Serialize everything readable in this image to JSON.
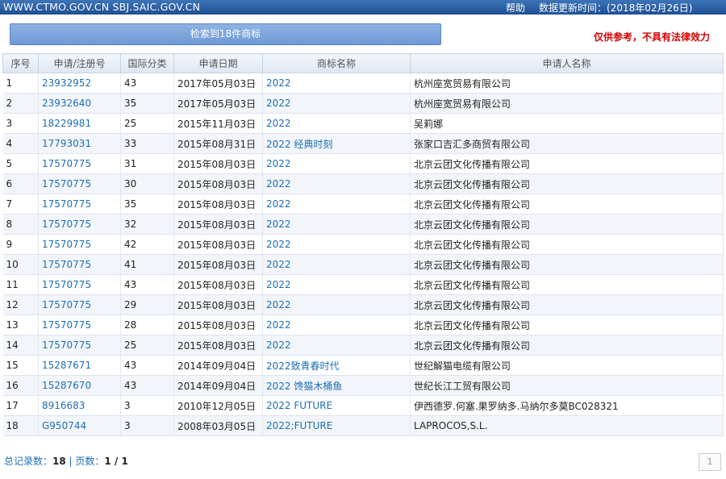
{
  "topbar": {
    "site_text": "WWW.CTMO.GOV.CN SBJ.SAIC.GOV.CN",
    "help_label": "帮助",
    "update_text": "数据更新时间：(2018年02月26日)"
  },
  "search": {
    "result_label": "检索到18件商标"
  },
  "disclaimer": "仅供参考，不具有法律效力",
  "table": {
    "headers": [
      "序号",
      "申请/注册号",
      "国际分类",
      "申请日期",
      "商标名称",
      "申请人名称"
    ],
    "rows": [
      [
        "1",
        "23932952",
        "43",
        "2017年05月03日",
        "2022",
        "杭州座宽贸易有限公司"
      ],
      [
        "2",
        "23932640",
        "35",
        "2017年05月03日",
        "2022",
        "杭州座宽贸易有限公司"
      ],
      [
        "3",
        "18229981",
        "25",
        "2015年11月03日",
        "2022",
        "吴莉娜"
      ],
      [
        "4",
        "17793031",
        "33",
        "2015年08月31日",
        "2022 经典时刻",
        "张家口吉汇多商贸有限公司"
      ],
      [
        "5",
        "17570775",
        "31",
        "2015年08月03日",
        "2022",
        "北京云团文化传播有限公司"
      ],
      [
        "6",
        "17570775",
        "30",
        "2015年08月03日",
        "2022",
        "北京云团文化传播有限公司"
      ],
      [
        "7",
        "17570775",
        "35",
        "2015年08月03日",
        "2022",
        "北京云团文化传播有限公司"
      ],
      [
        "8",
        "17570775",
        "32",
        "2015年08月03日",
        "2022",
        "北京云团文化传播有限公司"
      ],
      [
        "9",
        "17570775",
        "42",
        "2015年08月03日",
        "2022",
        "北京云团文化传播有限公司"
      ],
      [
        "10",
        "17570775",
        "41",
        "2015年08月03日",
        "2022",
        "北京云团文化传播有限公司"
      ],
      [
        "11",
        "17570775",
        "43",
        "2015年08月03日",
        "2022",
        "北京云团文化传播有限公司"
      ],
      [
        "12",
        "17570775",
        "29",
        "2015年08月03日",
        "2022",
        "北京云团文化传播有限公司"
      ],
      [
        "13",
        "17570775",
        "28",
        "2015年08月03日",
        "2022",
        "北京云团文化传播有限公司"
      ],
      [
        "14",
        "17570775",
        "25",
        "2015年08月03日",
        "2022",
        "北京云团文化传播有限公司"
      ],
      [
        "15",
        "15287671",
        "43",
        "2014年09月04日",
        "2022致青春时代",
        "世纪解猫电缆有限公司"
      ],
      [
        "16",
        "15287670",
        "43",
        "2014年09月04日",
        "2022 馋猫木桶鱼",
        "世纪长江工贸有限公司"
      ],
      [
        "17",
        "8916683",
        "3",
        "2010年12月05日",
        "2022 FUTURE",
        "伊西德罗.何塞.果罗纳多.马纳尔多莫BC028321"
      ],
      [
        "18",
        "G950744",
        "3",
        "2008年03月05日",
        "2022;FUTURE",
        "LAPROCOS,S.L."
      ]
    ]
  },
  "footer": {
    "total_label": "总记录数：",
    "total_value": "18",
    "separator": " | ",
    "pages_label": "页数：",
    "pages_value": "1 / 1"
  },
  "page_box": "1"
}
